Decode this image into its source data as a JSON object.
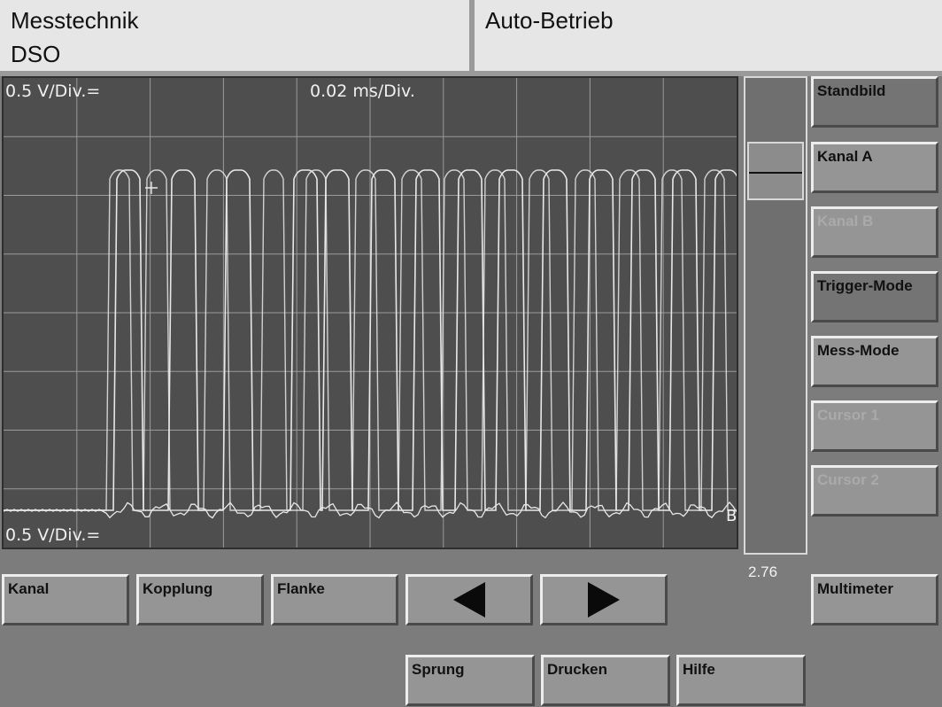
{
  "header": {
    "title": "Messtechnik",
    "subtitle": "DSO",
    "mode": "Auto-Betrieb"
  },
  "scope": {
    "volts_per_div_a": "0.5 V/Div.=",
    "time_per_div": "0.02 ms/Div.",
    "volts_per_div_b": "0.5 V/Div.=",
    "channel_b_marker": "B",
    "grid_divisions": {
      "x": 10,
      "y": 8
    },
    "trace_color": "#e8e8e8",
    "grid_color": "#9a9a9a",
    "background_color": "#4e4e4e"
  },
  "trigger": {
    "value": "2.76",
    "level_fraction": 0.2
  },
  "side_buttons": [
    {
      "label": "Standbild",
      "state": "active"
    },
    {
      "label": "Kanal A",
      "state": "normal"
    },
    {
      "label": "Kanal B",
      "state": "disabled"
    },
    {
      "label": "Trigger-Mode",
      "state": "active"
    },
    {
      "label": "Mess-Mode",
      "state": "normal"
    },
    {
      "label": "Cursor 1",
      "state": "disabled"
    },
    {
      "label": "Cursor 2",
      "state": "disabled"
    },
    {
      "label": "Multimeter",
      "state": "normal"
    }
  ],
  "bottom_buttons": {
    "kanal": "Kanal",
    "kopplung": "Kopplung",
    "flanke": "Flanke",
    "left_arrow_icon": "triangle-left-icon",
    "right_arrow_icon": "triangle-right-icon",
    "sprung": "Sprung",
    "drucken": "Drucken",
    "hilfe": "Hilfe"
  }
}
